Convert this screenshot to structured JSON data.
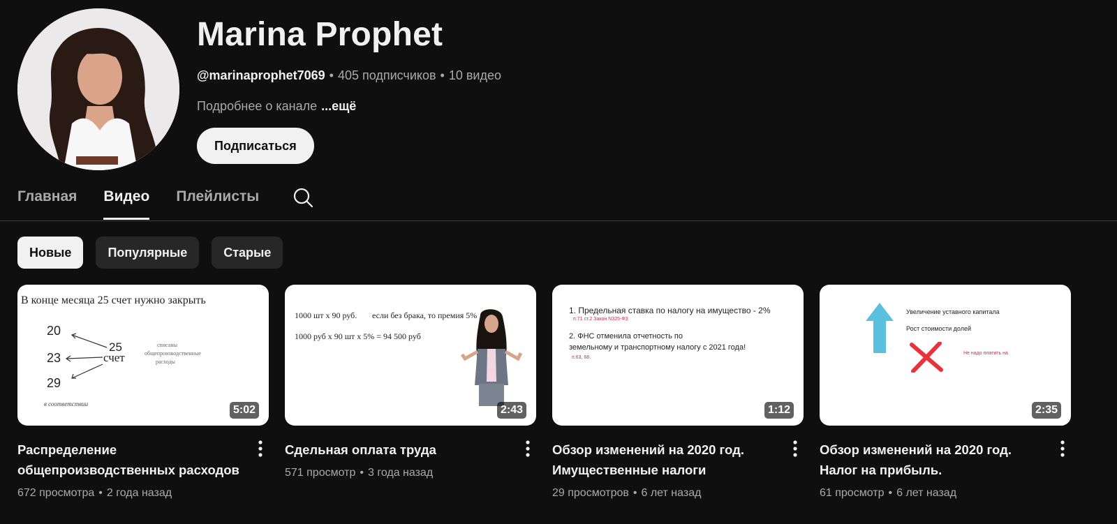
{
  "channel": {
    "name": "Marina Prophet",
    "handle": "@marinaprophet7069",
    "subscribers": "405 подписчиков",
    "videos_count": "10 видео",
    "separator": "•",
    "description": "Подробнее о канале",
    "more": "...ещё",
    "subscribe_label": "Подписаться"
  },
  "tabs": [
    {
      "label": "Главная"
    },
    {
      "label": "Видео"
    },
    {
      "label": "Плейлисты"
    }
  ],
  "chips": [
    {
      "label": "Новые"
    },
    {
      "label": "Популярные"
    },
    {
      "label": "Старые"
    }
  ],
  "videos": [
    {
      "title": "Распределение общепроизводственных расходов",
      "views": "672 просмотра",
      "age": "2 года назад",
      "duration": "5:02",
      "thumb": {
        "heading": "В конце месяца 25 счет нужно закрыть",
        "n20": "20",
        "n23": "23",
        "n29": "29",
        "n25": "25",
        "schet": "счет",
        "note1": "списаны",
        "note2": "общепроизводственные",
        "note3": "расходы",
        "footer": "в соответствии"
      }
    },
    {
      "title": "Сдельная оплата труда",
      "views": "571 просмотр",
      "age": "3 года назад",
      "duration": "2:43",
      "thumb": {
        "line1a": "1000 шт х 90 руб.",
        "line1b": "если без брака, то премия 5%",
        "line2": "1000 руб х  90  шт х 5% = 94 500 руб"
      }
    },
    {
      "title": "Обзор изменений на 2020 год. Имущественные налоги",
      "views": "29 просмотров",
      "age": "6 лет назад",
      "duration": "1:12",
      "thumb": {
        "line1": "1. Предельная ставка по налогу на имущество - 2%",
        "ref1": "п.71 ст.2 Закон N325-ФЗ",
        "line2": "2. ФНС отменила отчетность по",
        "line3": "земельному и транспортному налогу с 2021 года!",
        "ref2": "п.63, 68."
      }
    },
    {
      "title": "Обзор изменений на 2020 год. Налог на прибыль.",
      "views": "61 просмотр",
      "age": "6 лет назад",
      "duration": "2:35",
      "thumb": {
        "line1": "Увеличение уставного капитала",
        "line2": "Рост стоимости долей",
        "note": "Не надо платить на"
      }
    }
  ],
  "colors": {
    "background": "#0f0f0f",
    "text_primary": "#f1f1f1",
    "text_secondary": "#aaaaaa",
    "chip_bg": "#272727",
    "arrow_blue": "#5bc0de",
    "cross_red": "#e8323c"
  },
  "icons": {
    "search": "search-icon",
    "menu": "more-vert-icon"
  }
}
